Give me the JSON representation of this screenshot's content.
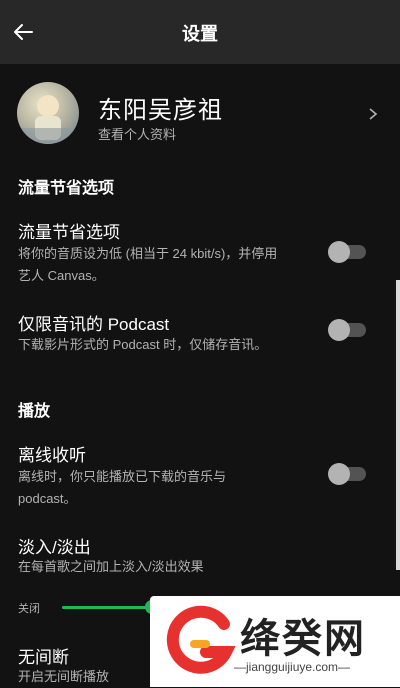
{
  "header": {
    "title": "设置",
    "back_icon": "arrow-left-icon"
  },
  "profile": {
    "name": "东阳吴彦祖",
    "subtitle": "查看个人资料",
    "chevron_icon": "chevron-right-icon"
  },
  "sections": {
    "data_saver": {
      "title": "流量节省选项",
      "rows": [
        {
          "title": "流量节省选项",
          "desc_line1": "将你的音质设为低 (相当于 24 kbit/s)，并停用",
          "desc_line2": "艺人 Canvas。",
          "toggle_on": false
        },
        {
          "title": "仅限音讯的 Podcast",
          "desc_line1": "下载影片形式的 Podcast 时，仅储存音讯。",
          "toggle_on": false
        }
      ]
    },
    "playback": {
      "title": "播放",
      "rows": [
        {
          "title": "离线收听",
          "desc_line1": "离线时，你只能播放已下载的音乐与",
          "desc_line2": "podcast。",
          "toggle_on": false
        },
        {
          "title": "淡入/淡出",
          "desc_line1": "在每首歌之间加上淡入/淡出效果"
        },
        {
          "title": "无间断",
          "desc_line1": "开启无间断播放"
        }
      ]
    }
  },
  "crossfade_slider": {
    "label": "关闭",
    "value_fraction": 0.3
  },
  "watermark": {
    "text": "绛癸网",
    "url": "—jiangguijiuye.com—"
  },
  "colors": {
    "background": "#121212",
    "topbar": "#282828",
    "accent_green": "#1db954",
    "secondary_text": "#b3b3b3",
    "toggle_off_track": "#535353"
  }
}
